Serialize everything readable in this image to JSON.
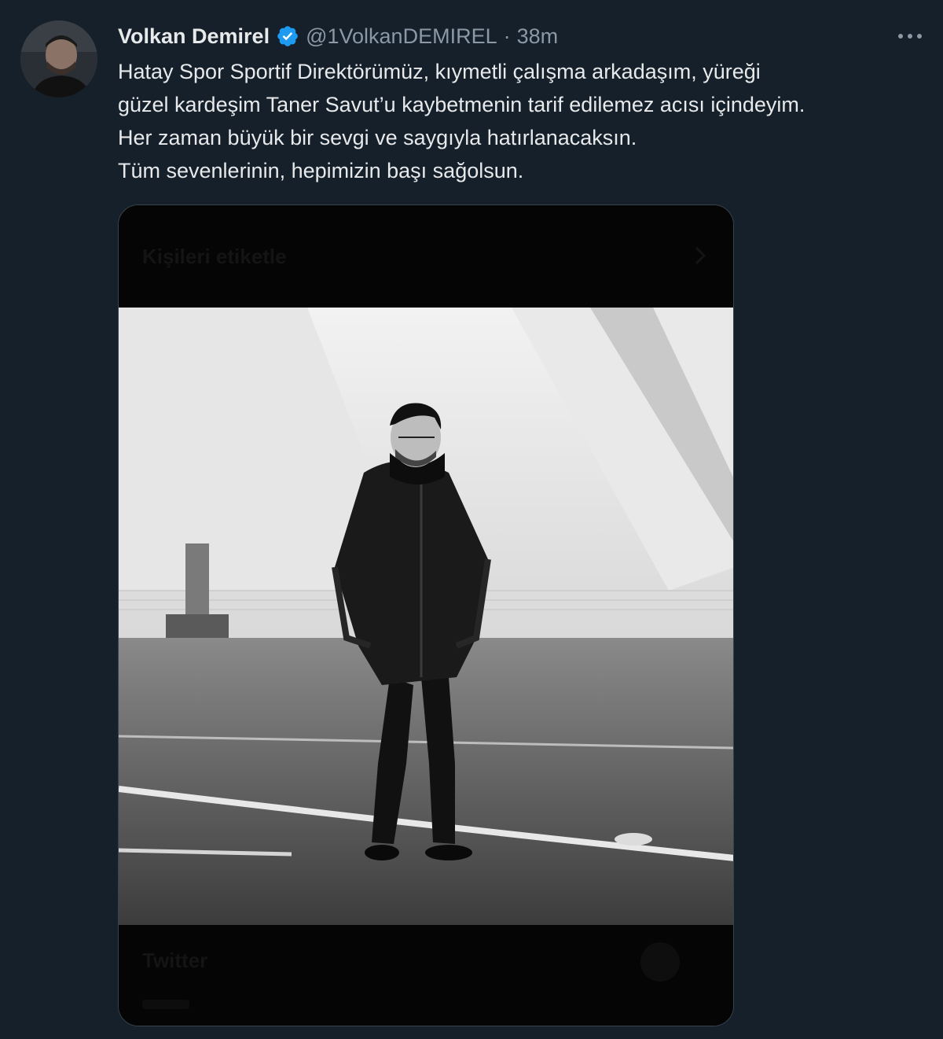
{
  "tweet": {
    "author": {
      "display_name": "Volkan Demirel",
      "handle": "@1VolkanDEMIREL",
      "verified": true,
      "verified_color": "#1d9bf0"
    },
    "separator": "·",
    "time": "38m",
    "more_icon": "more-horizontal-icon",
    "text_lines": [
      "Hatay Spor Sportif Direktörümüz, kıymetli çalışma arkadaşım, yüreği",
      "güzel kardeşim Taner Savut’u kaybetmenin tarif edilemez acısı içindeyim.",
      "Her zaman büyük bir sevgi ve saygıyla hatırlanacaksın.",
      "Tüm sevenlerinin, hepimizin başı sağolsun."
    ],
    "media": {
      "top_overlay_text": "Kişileri etiketle",
      "bottom_overlay_text": "Twitter"
    }
  },
  "colors": {
    "background": "#15202b",
    "text_primary": "#e7e9ea",
    "text_secondary": "#8b98a5"
  }
}
